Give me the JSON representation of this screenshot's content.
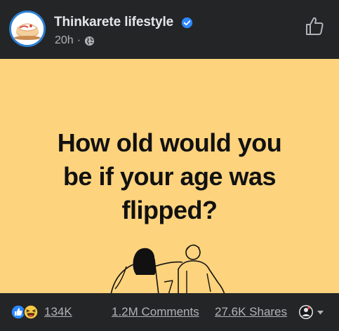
{
  "post": {
    "page_name": "Thinkarete lifestyle",
    "time": "20h",
    "separator": "·",
    "audience_icon": "globe-icon",
    "verified_icon": "verified-badge-icon",
    "like_page_icon": "thumbs-up-outline-icon"
  },
  "image": {
    "text_lines": [
      "How old would you",
      "be if your age was",
      "flipped?"
    ],
    "background_color": "#fdd37d"
  },
  "footer": {
    "reaction_icons": [
      "like-reaction-icon",
      "haha-reaction-icon"
    ],
    "reactions_count": "134K",
    "comments": "1.2M Comments",
    "shares": "27.6K Shares",
    "share_as_icon": "profile-avatar-icon",
    "dropdown_icon": "caret-down-icon"
  },
  "colors": {
    "background": "#242526",
    "primary_text": "#e4e6eb",
    "secondary_text": "#b0b3b8",
    "accent_blue": "#2d88ff"
  }
}
